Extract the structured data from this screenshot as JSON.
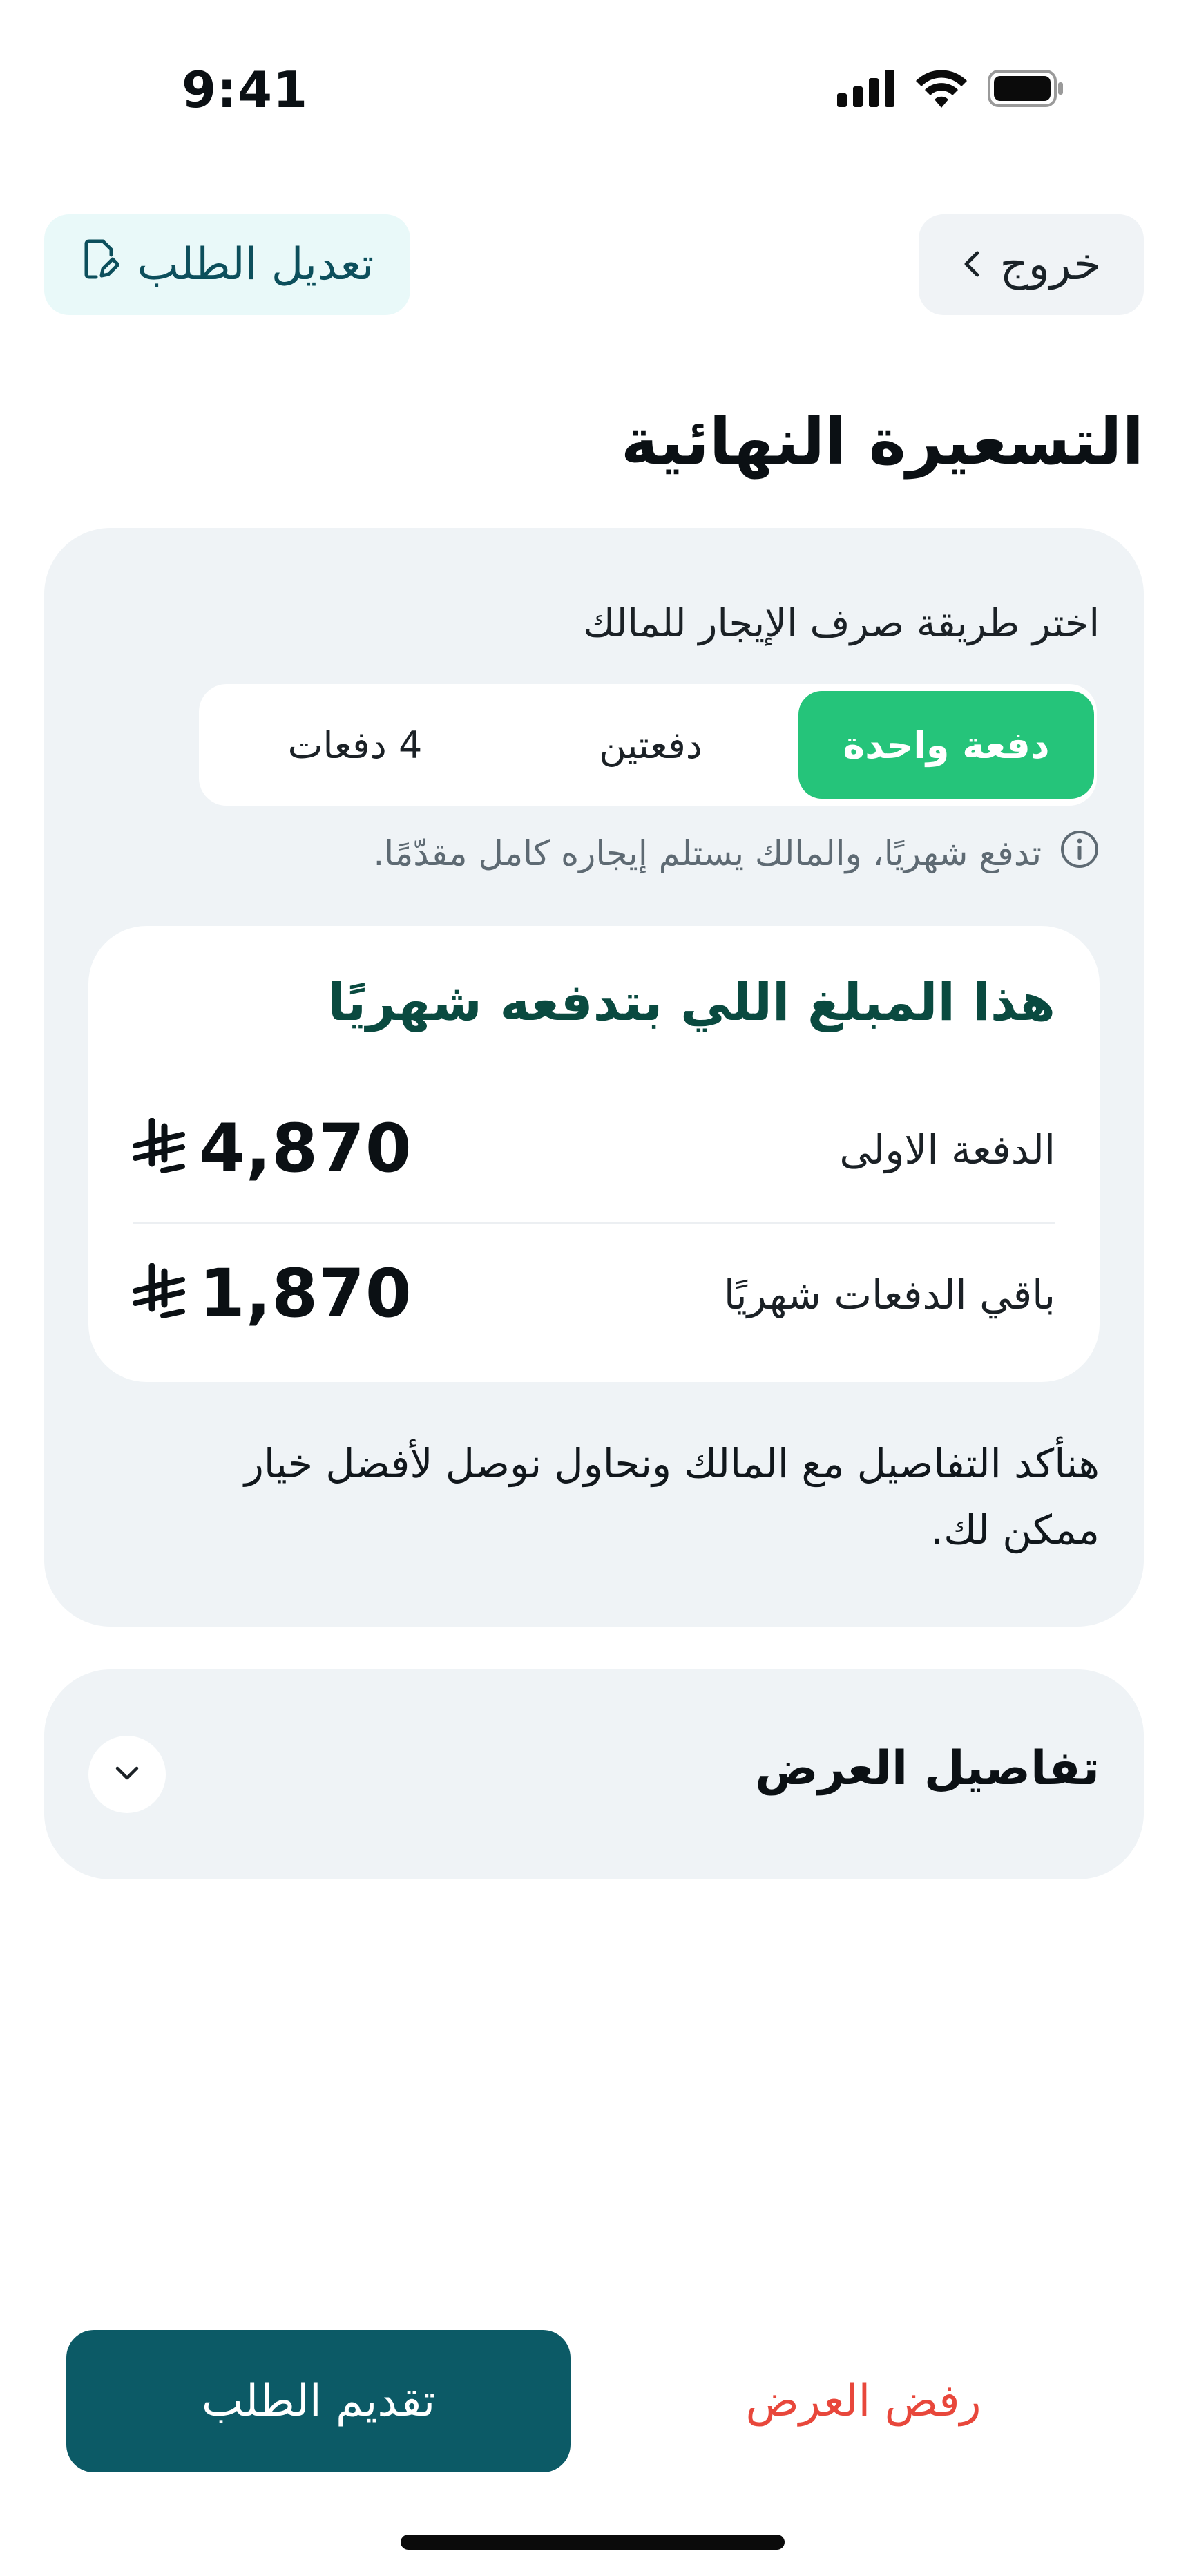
{
  "status_bar": {
    "time": "9:41"
  },
  "header": {
    "exit_label": "خروج",
    "edit_label": "تعديل الطلب"
  },
  "title": "التسعيرة النهائية",
  "payment": {
    "choose_label": "اختر طريقة صرف الإيجار للمالك",
    "options": [
      "دفعة واحدة",
      "دفعتين",
      "4 دفعات"
    ],
    "selected": "دفعة واحدة",
    "info": "تدفع شهريًا، والمالك يستلم إيجاره كامل مقدّمًا."
  },
  "summary": {
    "title": "هذا المبلغ اللي بتدفعه شهريًا",
    "first_payment_label": "الدفعة الاولى",
    "first_payment_amount": "4,870",
    "remaining_label": "باقي الدفعات شهريًا",
    "remaining_amount": "1,870",
    "currency_icon": "saudi-riyal-icon"
  },
  "note": "هنأكد التفاصيل مع المالك ونحاول نوصل لأفضل خيار ممكن لك.",
  "details": {
    "title": "تفاصيل العرض"
  },
  "actions": {
    "submit_label": "تقديم الطلب",
    "reject_label": "رفض العرض"
  },
  "colors": {
    "accent_green": "#25c47a",
    "primary_teal": "#0c5a66",
    "danger_red": "#e8473b",
    "panel_bg": "#eff3f6"
  }
}
